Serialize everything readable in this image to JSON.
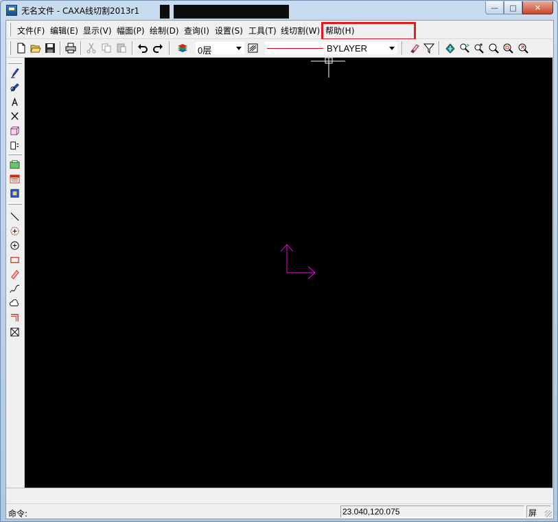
{
  "window": {
    "title": "无名文件 - CAXA线切割2013r1",
    "controls": {
      "minimize": "—",
      "maximize": "□",
      "close": "✕"
    }
  },
  "menu": [
    {
      "id": "file",
      "label": "文件(F)"
    },
    {
      "id": "edit",
      "label": "编辑(E)"
    },
    {
      "id": "view",
      "label": "显示(V)"
    },
    {
      "id": "format",
      "label": "幅面(P)"
    },
    {
      "id": "draw",
      "label": "绘制(D)"
    },
    {
      "id": "query",
      "label": "查询(I)"
    },
    {
      "id": "settings",
      "label": "设置(S)"
    },
    {
      "id": "tools",
      "label": "工具(T)"
    },
    {
      "id": "wirecut",
      "label": "线切割(W)"
    },
    {
      "id": "help",
      "label": "帮助(H)"
    }
  ],
  "toolbar": {
    "layer_value": "0层",
    "linetype_value": "BYLAYER",
    "line_color": "#e3001b",
    "icons": [
      "new-file-icon",
      "open-folder-icon",
      "save-icon",
      "print-icon",
      "cut-icon",
      "copy-icon",
      "paste-icon",
      "undo-icon",
      "redo-icon",
      "layers-icon",
      "linetype-icon",
      "eraser-icon",
      "filter-icon",
      "pan-icon",
      "dynamic-zoom-icon",
      "zoom-in-icon",
      "zoom-window-icon",
      "zoom-all-icon",
      "zoom-previous-icon"
    ]
  },
  "left_toolbar": {
    "icons": [
      "pen-icon",
      "pencil-icon",
      "text-icon",
      "scissors-icon",
      "block-icon",
      "dimension-icon",
      "image-icon",
      "hatch-icon",
      "layout-icon",
      "line-icon",
      "circle-center-icon",
      "circle-icon",
      "rectangle-icon",
      "eraser-tool-icon",
      "spline-icon",
      "cloud-icon",
      "polyline-icon",
      "crop-icon"
    ]
  },
  "canvas": {
    "background": "#000000",
    "axis_color": "#cc00cc",
    "cursor_color": "#ffffff"
  },
  "status": {
    "command_label": "命令:",
    "coordinates": "23.040,120.075",
    "screen_mode": "屏"
  },
  "highlight": {
    "target": "help",
    "color": "#e01a22"
  }
}
